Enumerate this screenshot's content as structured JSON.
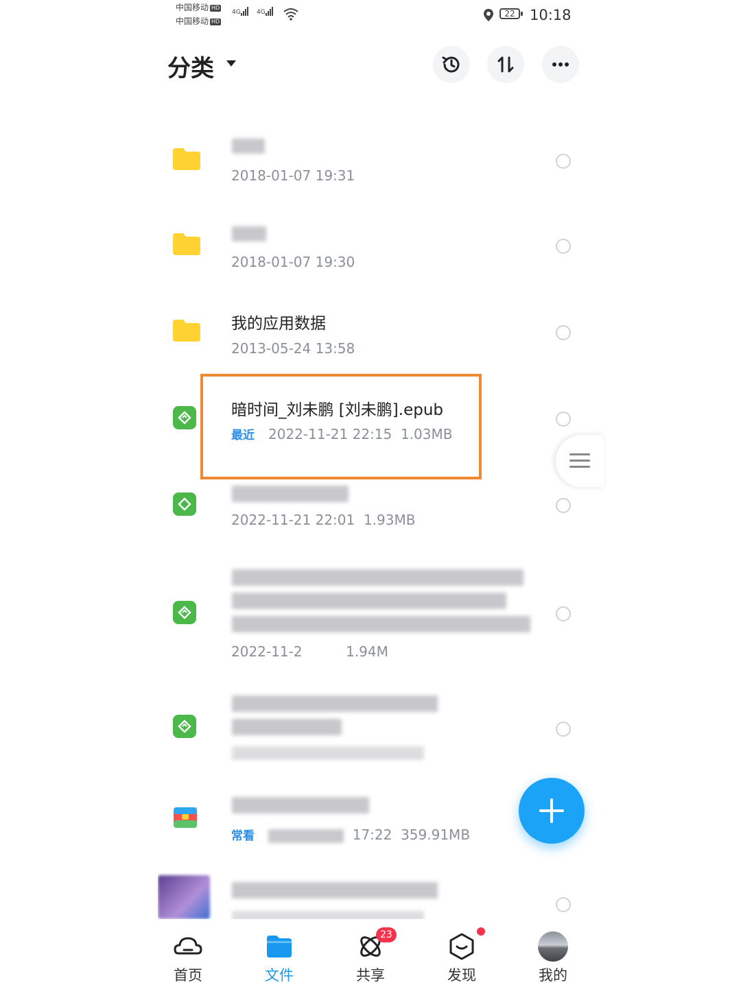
{
  "status_bar": {
    "carrier1": "中国移动",
    "carrier2": "中国移动",
    "hd": "HD",
    "net1": "4G",
    "net2": "4G",
    "battery": "22",
    "time": "10:18"
  },
  "header": {
    "title": "分类",
    "actions": [
      "history-icon",
      "sort-icon",
      "more-icon"
    ]
  },
  "files": [
    {
      "type": "folder",
      "title": "",
      "date": "2018-01-07  19:31",
      "tag": "",
      "size": ""
    },
    {
      "type": "folder",
      "title": "",
      "date": "2018-01-07  19:30",
      "tag": "",
      "size": ""
    },
    {
      "type": "folder",
      "title": "我的应用数据",
      "date": "2013-05-24  13:58",
      "tag": "",
      "size": ""
    },
    {
      "type": "epub",
      "title": "暗时间_刘未鹏 [刘未鹏].epub",
      "date": "2022-11-21  22:15",
      "tag": "最近",
      "size": "1.03MB"
    },
    {
      "type": "epub",
      "title": "",
      "date": "2022-11-21  22:01",
      "tag": "",
      "size": "1.93MB"
    },
    {
      "type": "epub",
      "title": "",
      "date": "2022-11-2",
      "tag": "",
      "size": "1.94M"
    },
    {
      "type": "epub",
      "title": "",
      "date": "",
      "tag": "",
      "size": ""
    },
    {
      "type": "archive",
      "title": "",
      "date": "17:22",
      "tag": "常看",
      "size": "359.91MB"
    },
    {
      "type": "video",
      "title": "",
      "date": "",
      "tag": "",
      "size": ""
    }
  ],
  "tabbar": {
    "home": "首页",
    "files": "文件",
    "share": "共享",
    "share_badge": "23",
    "discover": "发现",
    "mine": "我的"
  },
  "colors": {
    "accent": "#1aa3f7",
    "highlight": "#f08a32",
    "folder": "#ffd233",
    "epub": "#4cb84a",
    "badge": "#f5334b"
  }
}
